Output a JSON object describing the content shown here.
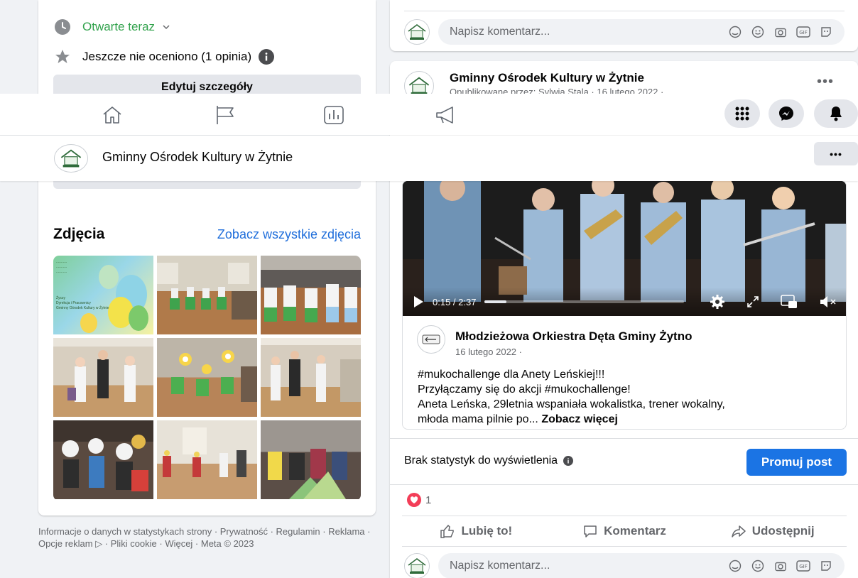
{
  "page": {
    "name": "Gminny Ośrodek Kultury w Żytnie",
    "more_label": "•••"
  },
  "about": {
    "hours_label": "Otwarte teraz",
    "rating_label": "Jeszcze nie oceniono (1 opinia)",
    "edit_label": "Edytuj szczegóły"
  },
  "photos": {
    "title": "Zdjęcia",
    "see_all": "Zobacz wszystkie zdjęcia",
    "poster_lines": [
      "...........",
      "...........",
      "...........",
      "Życzy",
      "Dyrekcja i Pracownicy",
      "Gminny Ośrodek Kultury w Żytnie"
    ]
  },
  "footer": {
    "text": "Informacje o danych w statystykach strony · Prywatność · Regulamin · Reklama · Opcje reklam ▷ · Pliki cookie · Więcej · Meta © 2023"
  },
  "comment": {
    "placeholder": "Napisz komentarz..."
  },
  "post": {
    "author": "Gminny Ośrodek Kultury w Żytnie",
    "subtitle": "Opublikowane przez: Sylwia Stala · 16 lutego 2022 · ",
    "more": "•••",
    "shared": {
      "author": "Młodzieżowa Orkiestra Dęta Gminy Żytno",
      "date": "16 lutego 2022 · ",
      "text_lines": [
        "#mukochallenge dla Anety Leńskiej!!!",
        "Przyłączamy się do akcji #mukochallenge!",
        "Aneta Leńska, 29letnia wspaniała wokalistka, trener wokalny,"
      ],
      "text_last": "młoda mama pilnie po... ",
      "see_more": "Zobacz więcej",
      "video_time": "0:15 / 2:37",
      "video_progress": 0.11
    },
    "stats_text": "Brak statystyk do wyświetlenia",
    "promote_label": "Promuj post",
    "reaction_count": "1",
    "actions": {
      "like": "Lubię to!",
      "comment": "Komentarz",
      "share": "Udostępnij"
    }
  },
  "colors": {
    "accent": "#1b74e4",
    "link": "#216fdb",
    "open_green": "#31a24c",
    "heart": "#f33e58"
  }
}
